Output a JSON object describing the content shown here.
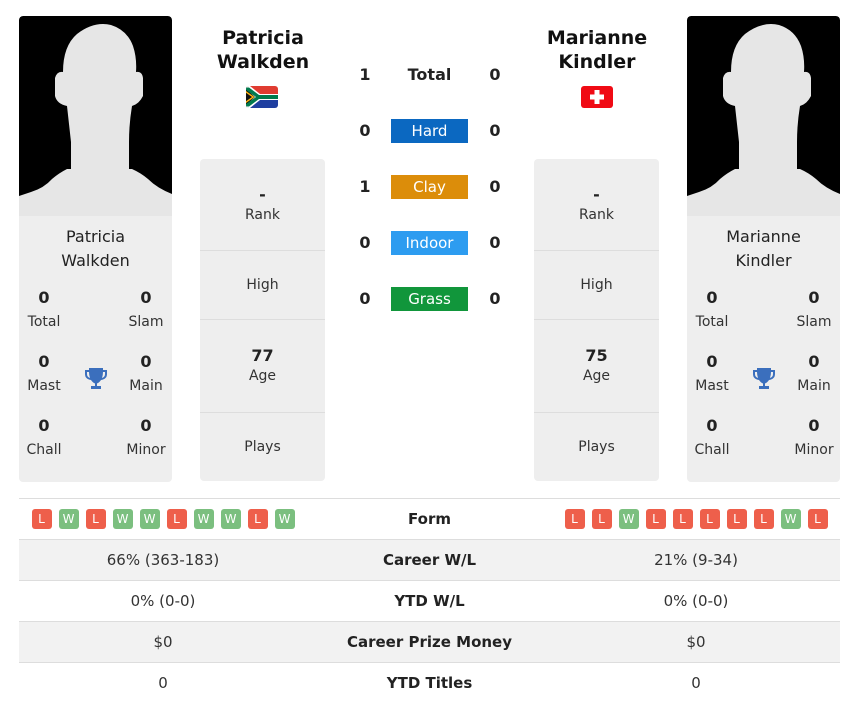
{
  "colors": {
    "hard": "#0b68c1",
    "clay": "#dc8d0a",
    "indoor": "#2d9cf0",
    "grass": "#11963b",
    "win": "#7bbf7f",
    "loss": "#ee5f4b",
    "trophy": "#3b6fbd"
  },
  "player1": {
    "name": "Patricia Walkden",
    "name_line1": "Patricia",
    "name_line2": "Walkden",
    "country_flag": "south-africa-flag",
    "titles": {
      "total": "0",
      "total_label": "Total",
      "slam": "0",
      "slam_label": "Slam",
      "mast": "0",
      "mast_label": "Mast",
      "main": "0",
      "main_label": "Main",
      "chall": "0",
      "chall_label": "Chall",
      "minor": "0",
      "minor_label": "Minor"
    },
    "rank": {
      "value": "-",
      "label": "Rank"
    },
    "high": {
      "value": "",
      "label": "High"
    },
    "age": {
      "value": "77",
      "label": "Age"
    },
    "plays": {
      "value": "",
      "label": "Plays"
    },
    "form": [
      "L",
      "W",
      "L",
      "W",
      "W",
      "L",
      "W",
      "W",
      "L",
      "W"
    ],
    "career_wl": "66% (363-183)",
    "ytd_wl": "0% (0-0)",
    "prize_money": "$0",
    "ytd_titles": "0"
  },
  "player2": {
    "name": "Marianne Kindler",
    "name_line1": "Marianne",
    "name_line2": "Kindler",
    "country_flag": "switzerland-flag",
    "titles": {
      "total": "0",
      "total_label": "Total",
      "slam": "0",
      "slam_label": "Slam",
      "mast": "0",
      "mast_label": "Mast",
      "main": "0",
      "main_label": "Main",
      "chall": "0",
      "chall_label": "Chall",
      "minor": "0",
      "minor_label": "Minor"
    },
    "rank": {
      "value": "-",
      "label": "Rank"
    },
    "high": {
      "value": "",
      "label": "High"
    },
    "age": {
      "value": "75",
      "label": "Age"
    },
    "plays": {
      "value": "",
      "label": "Plays"
    },
    "form": [
      "L",
      "L",
      "W",
      "L",
      "L",
      "L",
      "L",
      "L",
      "W",
      "L"
    ],
    "career_wl": "21% (9-34)",
    "ytd_wl": "0% (0-0)",
    "prize_money": "$0",
    "ytd_titles": "0"
  },
  "h2h": [
    {
      "label": "Total",
      "p1": "1",
      "p2": "0"
    },
    {
      "label": "Hard",
      "p1": "0",
      "p2": "0"
    },
    {
      "label": "Clay",
      "p1": "1",
      "p2": "0"
    },
    {
      "label": "Indoor",
      "p1": "0",
      "p2": "0"
    },
    {
      "label": "Grass",
      "p1": "0",
      "p2": "0"
    }
  ],
  "stats_labels": {
    "form": "Form",
    "career_wl": "Career W/L",
    "ytd_wl": "YTD W/L",
    "prize_money": "Career Prize Money",
    "ytd_titles": "YTD Titles"
  }
}
